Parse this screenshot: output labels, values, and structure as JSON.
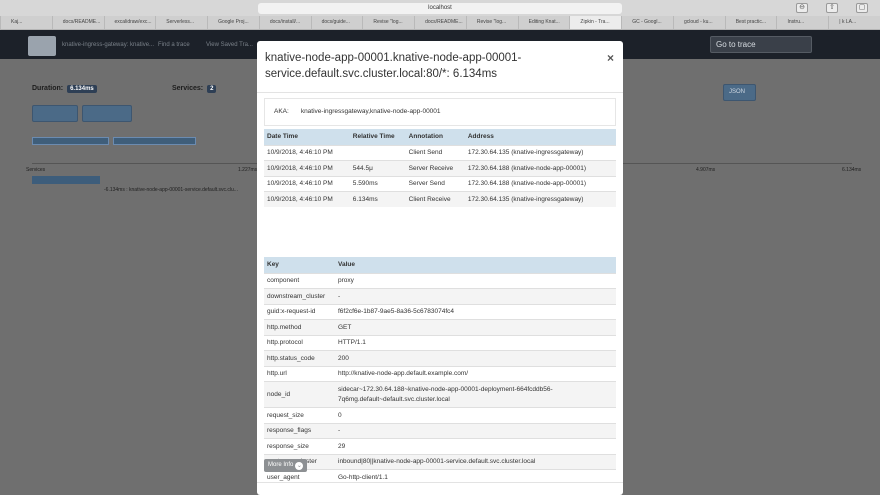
{
  "browser": {
    "url": "localhost",
    "tabs": [
      "Kaj...",
      "docs/README...",
      "excalidraw/exc...",
      "Serverless...",
      "Google Proj...",
      "docs/install/...",
      "docs/guide...",
      "Revise \"log...",
      "docs/README...",
      "Revise \"log...",
      "Editing Knat...",
      "Zipkin - Tra...",
      "GC - Googl...",
      "gcloud - ku...",
      "Best practic...",
      "Instru...",
      "| k LA..."
    ],
    "active_tab_index": 11
  },
  "app": {
    "header_links": [
      "knative-ingress-gateway: knative...",
      "Find a trace",
      "View Saved Tra..."
    ],
    "goto_label": "Go to trace",
    "duration_label": "Duration:",
    "duration_value": "6.134ms",
    "services_label": "Services:",
    "services_value": "2",
    "json_button": "JSON",
    "services_row_label": "Services",
    "timeline_ticks": [
      "1.227ms",
      "4.907ms",
      "6.134ms"
    ],
    "span_label": "-6.134ms : knative-node-app-00001-service.default.svc.clu..."
  },
  "modal": {
    "title": "knative-node-app-00001.knative-node-app-00001-service.default.svc.cluster.local:80/*: 6.134ms",
    "close": "×",
    "aka_label": "AKA:",
    "aka_value": "knative-ingressgateway,knative-node-app-00001",
    "annotations": {
      "headers": [
        "Date Time",
        "Relative Time",
        "Annotation",
        "Address"
      ],
      "rows": [
        [
          "10/9/2018, 4:46:10 PM",
          "",
          "Client Send",
          "172.30.64.135 (knative-ingressgateway)"
        ],
        [
          "10/9/2018, 4:46:10 PM",
          "544.5μ",
          "Server Receive",
          "172.30.64.188 (knative-node-app-00001)"
        ],
        [
          "10/9/2018, 4:46:10 PM",
          "5.590ms",
          "Server Send",
          "172.30.64.188 (knative-node-app-00001)"
        ],
        [
          "10/9/2018, 4:46:10 PM",
          "6.134ms",
          "Client Receive",
          "172.30.64.135 (knative-ingressgateway)"
        ]
      ]
    },
    "tags": {
      "headers": [
        "Key",
        "Value"
      ],
      "rows": [
        [
          "component",
          "proxy"
        ],
        [
          "downstream_cluster",
          "-"
        ],
        [
          "guid:x-request-id",
          "f6f2cf6e-1b87-9ae5-8a36-5c6783074fc4"
        ],
        [
          "http.method",
          "GET"
        ],
        [
          "http.protocol",
          "HTTP/1.1"
        ],
        [
          "http.status_code",
          "200"
        ],
        [
          "http.url",
          "http://knative-node-app.default.example.com/"
        ],
        [
          "node_id",
          "sidecar~172.30.64.188~knative-node-app-00001-deployment-664fcddb56-7q6mg.default~default.svc.cluster.local"
        ],
        [
          "request_size",
          "0"
        ],
        [
          "response_flags",
          "-"
        ],
        [
          "response_size",
          "29"
        ],
        [
          "upstream_cluster",
          "inbound|80||knative-node-app-00001-service.default.svc.cluster.local"
        ],
        [
          "user_agent",
          "Go-http-client/1.1"
        ]
      ]
    },
    "more_info": "More Info"
  }
}
